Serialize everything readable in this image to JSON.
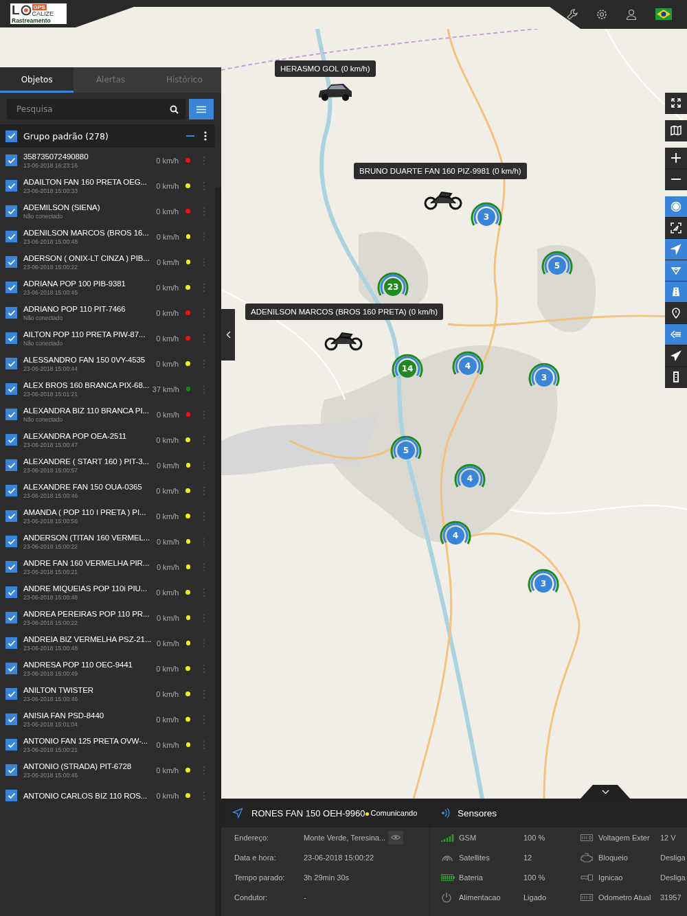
{
  "header": {
    "logo": {
      "letter": "L",
      "badge": "GPS",
      "name": "CALIZE",
      "tagline": "Rastreamento"
    },
    "icons": [
      {
        "kind": "wrench"
      },
      {
        "kind": "gear"
      },
      {
        "kind": "user"
      },
      {
        "kind": "flag"
      }
    ]
  },
  "sidebar": {
    "tabs": [
      {
        "label": "Objetos",
        "selected": true
      },
      {
        "label": "Alertas",
        "selected": false
      },
      {
        "label": "Histórico",
        "selected": false
      }
    ],
    "search": {
      "placeholder": "Pesquisa"
    },
    "group": {
      "label": "Grupo padrão (278)",
      "checked": true
    },
    "objects": [
      {
        "name": "358735072490880",
        "sub": "13-06-2018 16:23:16",
        "speed": "0 km/h",
        "color": "#ee1111",
        "checked": true
      },
      {
        "name": "ADAILTON FAN 160 PRETA OEG...",
        "sub": "23-06-2018 15:00:33",
        "speed": "0 km/h",
        "color": "#eeee22",
        "checked": true
      },
      {
        "name": "ADEMILSON (SIENA)",
        "sub": "Não conectado",
        "speed": "0 km/h",
        "color": "#ee1111",
        "checked": true
      },
      {
        "name": "ADENILSON MARCOS (BROS 16...",
        "sub": "23-06-2018 15:00:48",
        "speed": "0 km/h",
        "color": "#eeee22",
        "checked": true
      },
      {
        "name": "ADERSON ( ONIX-LT CINZA ) PIB...",
        "sub": "23-06-2018 15:00:22",
        "speed": "0 km/h",
        "color": "#eeee22",
        "checked": true
      },
      {
        "name": "ADRIANA POP 100 PIB-9381",
        "sub": "23-06-2018 15:00:45",
        "speed": "0 km/h",
        "color": "#eeee22",
        "checked": true
      },
      {
        "name": "ADRIANO POP 110 PIT-7466",
        "sub": "Não conectado",
        "speed": "0 km/h",
        "color": "#ee1111",
        "checked": true
      },
      {
        "name": "AILTON POP 110 PRETA PIW-87...",
        "sub": "Não conectado",
        "speed": "0 km/h",
        "color": "#ee1111",
        "checked": true
      },
      {
        "name": "ALESSANDRO FAN 150 0VY-4535",
        "sub": "23-06-2018 15:00:44",
        "speed": "0 km/h",
        "color": "#eeee22",
        "checked": true
      },
      {
        "name": "ALEX BROS 160 BRANCA PIX-68...",
        "sub": "23-06-2018 15:01:21",
        "speed": "37 km/h",
        "color": "#118811",
        "checked": true
      },
      {
        "name": "ALEXANDRA BIZ 110 BRANCA PI...",
        "sub": "Não conectado",
        "speed": "0 km/h",
        "color": "#ee1111",
        "checked": true
      },
      {
        "name": "ALEXANDRA POP OEA-2511",
        "sub": "23-06-2018 15:00:47",
        "speed": "0 km/h",
        "color": "#eeee22",
        "checked": true
      },
      {
        "name": "ALEXANDRE ( START 160 ) PIT-3...",
        "sub": "23-06-2018 15:00:57",
        "speed": "0 km/h",
        "color": "#eeee22",
        "checked": true
      },
      {
        "name": "ALEXANDRE FAN 150 OUA-0365",
        "sub": "23-06-2018 15:00:46",
        "speed": "0 km/h",
        "color": "#eeee22",
        "checked": true
      },
      {
        "name": "AMANDA ( POP 110 I PRETA ) PI...",
        "sub": "23-06-2018 15:00:56",
        "speed": "0 km/h",
        "color": "#eeee22",
        "checked": true
      },
      {
        "name": "ANDERSON (TITAN 160 VERMEL...",
        "sub": "23-06-2018 15:00:22",
        "speed": "0 km/h",
        "color": "#eeee22",
        "checked": true
      },
      {
        "name": "ANDRE FAN 160 VERMELHA PIR...",
        "sub": "23-06-2018 15:00:21",
        "speed": "0 km/h",
        "color": "#eeee22",
        "checked": true
      },
      {
        "name": "ANDRE MIQUEIAS POP 110i PIU...",
        "sub": "23-06-2018 15:00:48",
        "speed": "0 km/h",
        "color": "#eeee22",
        "checked": true
      },
      {
        "name": "ANDREA PEREIRAS POP 110 PR...",
        "sub": "23-06-2018 15:00:22",
        "speed": "0 km/h",
        "color": "#eeee22",
        "checked": true
      },
      {
        "name": "ANDREIA BIZ VERMELHA PSZ-21...",
        "sub": "23-06-2018 15:00:48",
        "speed": "0 km/h",
        "color": "#eeee22",
        "checked": true
      },
      {
        "name": "ANDRESA POP 110 OEC-9441",
        "sub": "23-06-2018 15:00:49",
        "speed": "0 km/h",
        "color": "#eeee22",
        "checked": true
      },
      {
        "name": "ANILTON TWISTER",
        "sub": "23-06-2018 15:00:46",
        "speed": "0 km/h",
        "color": "#eeee22",
        "checked": true
      },
      {
        "name": "ANISIA FAN PSD-8440",
        "sub": "23-06-2018 15:01:04",
        "speed": "0 km/h",
        "color": "#eeee22",
        "checked": true
      },
      {
        "name": "ANTONIO FAN 125 PRETA OVW-...",
        "sub": "23-06-2018 15:00:21",
        "speed": "0 km/h",
        "color": "#eeee22",
        "checked": true
      },
      {
        "name": "ANTONIO (STRADA) PIT-6728",
        "sub": "23-06-2018 15:00:46",
        "speed": "0 km/h",
        "color": "#eeee22",
        "checked": true
      },
      {
        "name": "ANTONIO CARLOS BIZ 110 ROS...",
        "speed": "0 km/h",
        "color": "#eeee22",
        "checked": true
      }
    ]
  },
  "map": {
    "tooltips": [
      {
        "label": "HERASMO GOL (0 km/h)",
        "kind": "car"
      },
      {
        "label": "BRUNO DUARTE FAN 160 PIZ-9981 (0 km/h)",
        "kind": "moto"
      },
      {
        "label": "ADENILSON MARCOS (BROS 160 PRETA) (0 km/h)",
        "kind": "moto"
      }
    ],
    "clusters": [
      {
        "count": "3",
        "color": "#3a85d8"
      },
      {
        "count": "5",
        "color": "#3a85d8"
      },
      {
        "count": "23",
        "color": "#1f8a1f"
      },
      {
        "count": "14",
        "color": "#1f8a1f"
      },
      {
        "count": "4",
        "color": "#3a85d8"
      },
      {
        "count": "3",
        "color": "#3a85d8"
      },
      {
        "count": "5",
        "color": "#3a85d8"
      },
      {
        "count": "4",
        "color": "#3a85d8"
      },
      {
        "count": "4",
        "color": "#3a85d8"
      },
      {
        "count": "3",
        "color": "#3a85d8"
      }
    ],
    "tool_groups": [
      [
        {
          "kind": "fullscreen",
          "active": false
        }
      ],
      [
        {
          "kind": "map",
          "active": false
        }
      ],
      [
        {
          "kind": "zoom-in",
          "active": false
        },
        {
          "kind": "zoom-out",
          "active": false
        }
      ],
      [
        {
          "kind": "cluster",
          "active": true
        },
        {
          "kind": "frame",
          "active": false
        },
        {
          "kind": "navigate",
          "active": true
        },
        {
          "kind": "route",
          "active": true
        },
        {
          "kind": "road",
          "active": true
        },
        {
          "kind": "pin",
          "active": false
        },
        {
          "kind": "list",
          "active": true
        },
        {
          "kind": "pointer",
          "active": false
        },
        {
          "kind": "traffic",
          "active": false
        }
      ]
    ]
  },
  "details": {
    "title": "RONES FAN 150 OEH-9960",
    "status": {
      "label": "Comunicando",
      "color": "#eeee22"
    },
    "fields": [
      {
        "label": "Endereço:",
        "value": "Monte Verde, Teresina...",
        "kind": "address"
      },
      {
        "label": "Data e hora:",
        "value": "23-06-2018 15:00:22"
      },
      {
        "label": "Tempo parado:",
        "value": "3h 29min 30s"
      },
      {
        "label": "Condutor:",
        "value": "-"
      }
    ]
  },
  "sensors": {
    "title": "Sensores",
    "columns": [
      [
        {
          "kind": "signal",
          "label": "GSM",
          "value": "100 %"
        },
        {
          "kind": "satellite",
          "label": "Satellites",
          "value": "12"
        },
        {
          "kind": "battery",
          "label": "Bateria",
          "value": "100 %"
        },
        {
          "kind": "power",
          "label": "Alimentacao",
          "value": "Ligado"
        }
      ],
      [
        {
          "kind": "meter",
          "label": "Voltagem Exter",
          "value": "12 V"
        },
        {
          "kind": "engine",
          "label": "Bloqueio",
          "value": "Desliga"
        },
        {
          "kind": "key",
          "label": "Ignicao",
          "value": "Desliga"
        },
        {
          "kind": "meter",
          "label": "Odometro Atual",
          "value": "31957"
        }
      ]
    ]
  }
}
